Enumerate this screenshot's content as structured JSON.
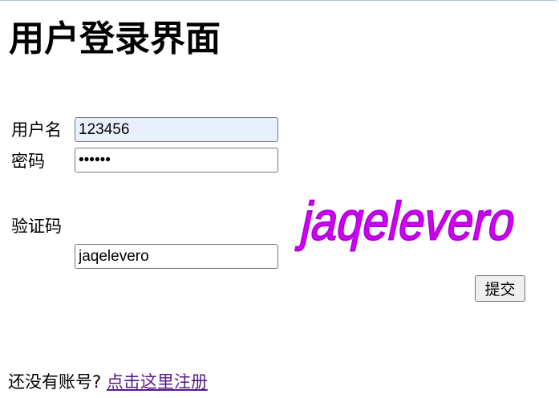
{
  "title": "用户登录界面",
  "form": {
    "username_label": "用户名",
    "username_value": "123456",
    "password_label": "密码",
    "password_value": "123456",
    "captcha_label": "验证码",
    "captcha_value": "jaqelevero",
    "captcha_image_text": "jaqelevero",
    "captcha_color": "#d400f0",
    "submit_label": "提交"
  },
  "footer": {
    "prompt": "还没有账号?",
    "register_link": "点击这里注册"
  }
}
